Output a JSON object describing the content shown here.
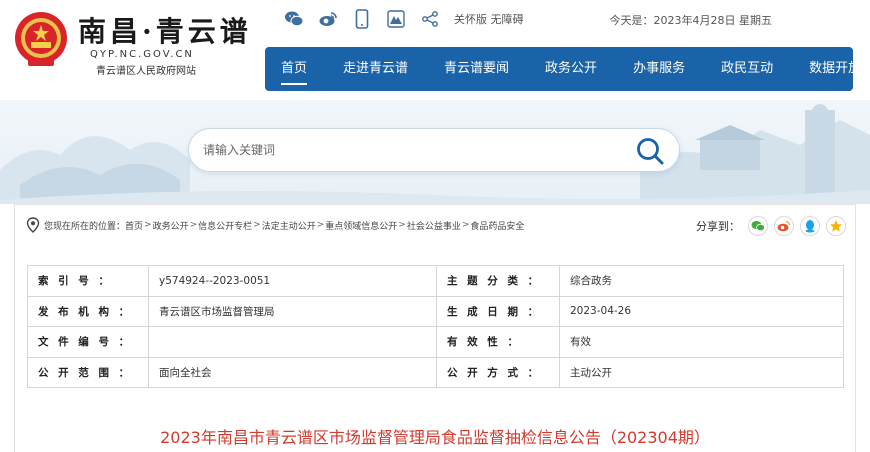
{
  "header": {
    "site_name": "南昌·青云谱",
    "site_domain": "QYP.NC.GOV.CN",
    "site_subtitle": "青云谱区人民政府网站",
    "access_link": "关怀版 无障碍",
    "date_text": "今天是：2023年4月28日 星期五",
    "tool_icons": [
      "wechat-icon",
      "weibo-icon",
      "mobile-icon",
      "app-icon",
      "share-icon"
    ]
  },
  "nav": {
    "items": [
      {
        "label": "首页",
        "active": true
      },
      {
        "label": "走进青云谱"
      },
      {
        "label": "青云谱要闻"
      },
      {
        "label": "政务公开"
      },
      {
        "label": "办事服务"
      },
      {
        "label": "政民互动"
      },
      {
        "label": "数据开放"
      }
    ]
  },
  "search": {
    "placeholder": "请输入关键词",
    "value": ""
  },
  "breadcrumb": {
    "prefix": "您现在所在的位置：",
    "items": [
      "首页",
      "政务公开",
      "信息公开专栏",
      "法定主动公开",
      "重点领域信息公开",
      "社会公益事业",
      "食品药品安全"
    ],
    "separator": ">"
  },
  "share": {
    "label": "分享到：",
    "targets": [
      "wechat",
      "weibo",
      "qq",
      "qzone"
    ],
    "colors": {
      "wechat": "#3cb034",
      "weibo": "#e6512d",
      "qq": "#1aa1e6",
      "qzone": "#f5b700"
    }
  },
  "meta": {
    "rows": [
      {
        "k1": "索 引 号 ：",
        "v1": "y574924--2023-0051",
        "k2": "主 题 分 类 ：",
        "v2": "综合政务"
      },
      {
        "k1": "发 布 机 构 ：",
        "v1": "青云谱区市场监督管理局",
        "k2": "生 成 日 期 ：",
        "v2": "2023-04-26"
      },
      {
        "k1": "文 件 编 号 ：",
        "v1": "",
        "k2": "有 效 性 ：",
        "v2": "有效"
      },
      {
        "k1": "公 开 范 围 ：",
        "v1": "面向全社会",
        "k2": "公 开 方 式 ：",
        "v2": "主动公开"
      }
    ]
  },
  "article": {
    "title": "2023年南昌市青云谱区市场监督管理局食品监督抽检信息公告（202304期）"
  },
  "colors": {
    "nav_bg": "#1b63a8",
    "title_red": "#d23a2e"
  }
}
